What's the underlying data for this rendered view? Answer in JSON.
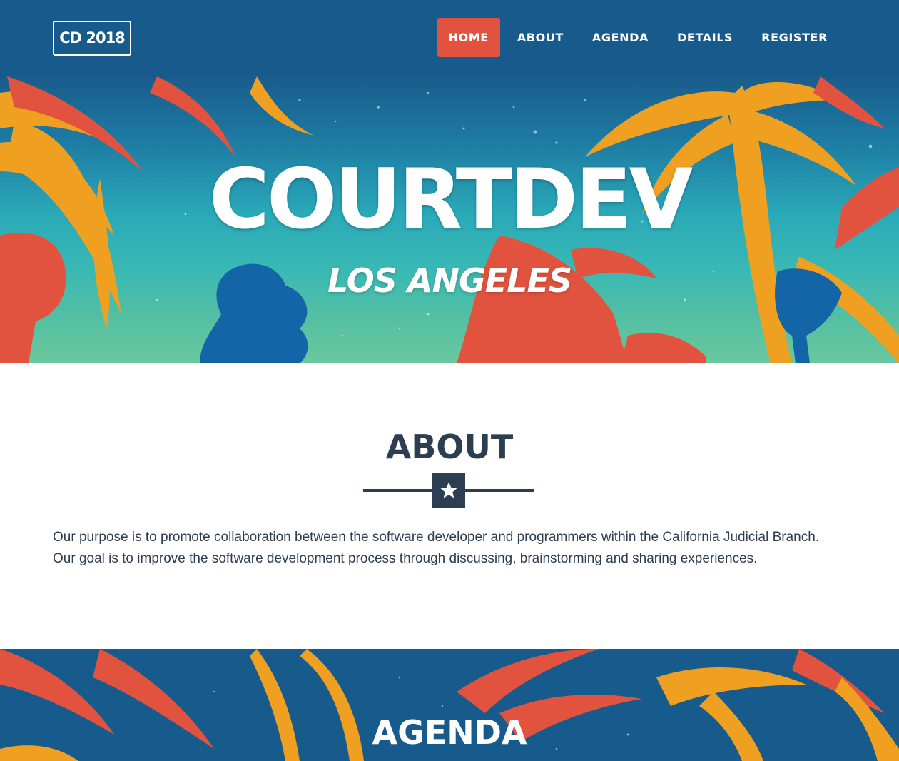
{
  "navbar": {
    "logo_text": "CD 2018",
    "items": [
      {
        "label": "HOME",
        "active": true
      },
      {
        "label": "ABOUT",
        "active": false
      },
      {
        "label": "AGENDA",
        "active": false
      },
      {
        "label": "DETAILS",
        "active": false
      },
      {
        "label": "REGISTER",
        "active": false
      }
    ]
  },
  "hero": {
    "title": "COURTDEV",
    "subtitle": "LOS ANGELES"
  },
  "about": {
    "heading": "ABOUT",
    "divider_icon": "star-icon",
    "text": "Our purpose is to promote collaboration between the software developer and programmers within the California Judicial Branch. Our goal is to improve the software development process through discussing, brainstorming and sharing experiences."
  },
  "agenda": {
    "heading": "AGENDA"
  },
  "colors": {
    "navy": "#175a8c",
    "accent_red": "#e2533f",
    "palm_orange": "#f0a020",
    "palm_red": "#e2533f",
    "palm_blue": "#1464a8",
    "text_dark": "#2c3e50"
  }
}
